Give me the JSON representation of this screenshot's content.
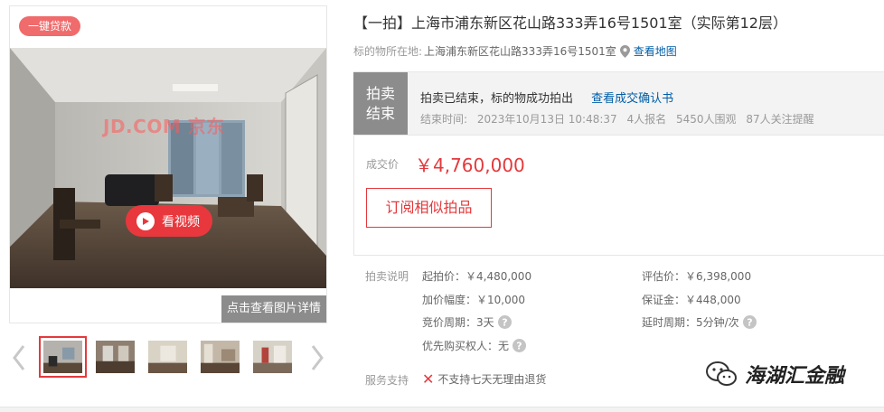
{
  "gallery": {
    "loan_badge": "一键贷款",
    "watermark": "JD.COM 京东",
    "video_button": "看视频",
    "detail_button": "点击查看图片详情",
    "thumbnail_count": 5,
    "active_thumbnail": 0
  },
  "listing": {
    "title": "【一拍】上海市浦东新区花山路333弄16号1501室（实际第12层）",
    "location_label": "标的物所在地:",
    "location_address": "上海浦东新区花山路333弄16号1501室",
    "map_link": "查看地图"
  },
  "status": {
    "tag": "拍卖结束",
    "message": "拍卖已结束，标的物成功拍出",
    "confirm_link": "查看成交确认书",
    "end_time_label": "结束时间:",
    "end_time": "2023年10月13日 10:48:37",
    "signups": "4人报名",
    "viewers": "5450人围观",
    "followers": "87人关注提醒"
  },
  "deal": {
    "label": "成交价",
    "price": "￥4,760,000",
    "subscribe_button": "订阅相似拍品"
  },
  "rules": {
    "label": "拍卖说明",
    "start_price": "起拍价：￥4,480,000",
    "appraisal": "评估价：￥6,398,000",
    "increment": "加价幅度：￥10,000",
    "deposit": "保证金：￥448,000",
    "bid_period": "竞价周期：3天",
    "extension": "延时周期：5分钟/次",
    "priority": "优先购买权人：无"
  },
  "service": {
    "label": "服务支持",
    "value": "不支持七天无理由退货"
  },
  "brand": {
    "name": "海湖汇金融"
  },
  "colors": {
    "accent_red": "#e4393c",
    "link_blue": "#005ea7",
    "status_gray": "#8c8c8c"
  }
}
